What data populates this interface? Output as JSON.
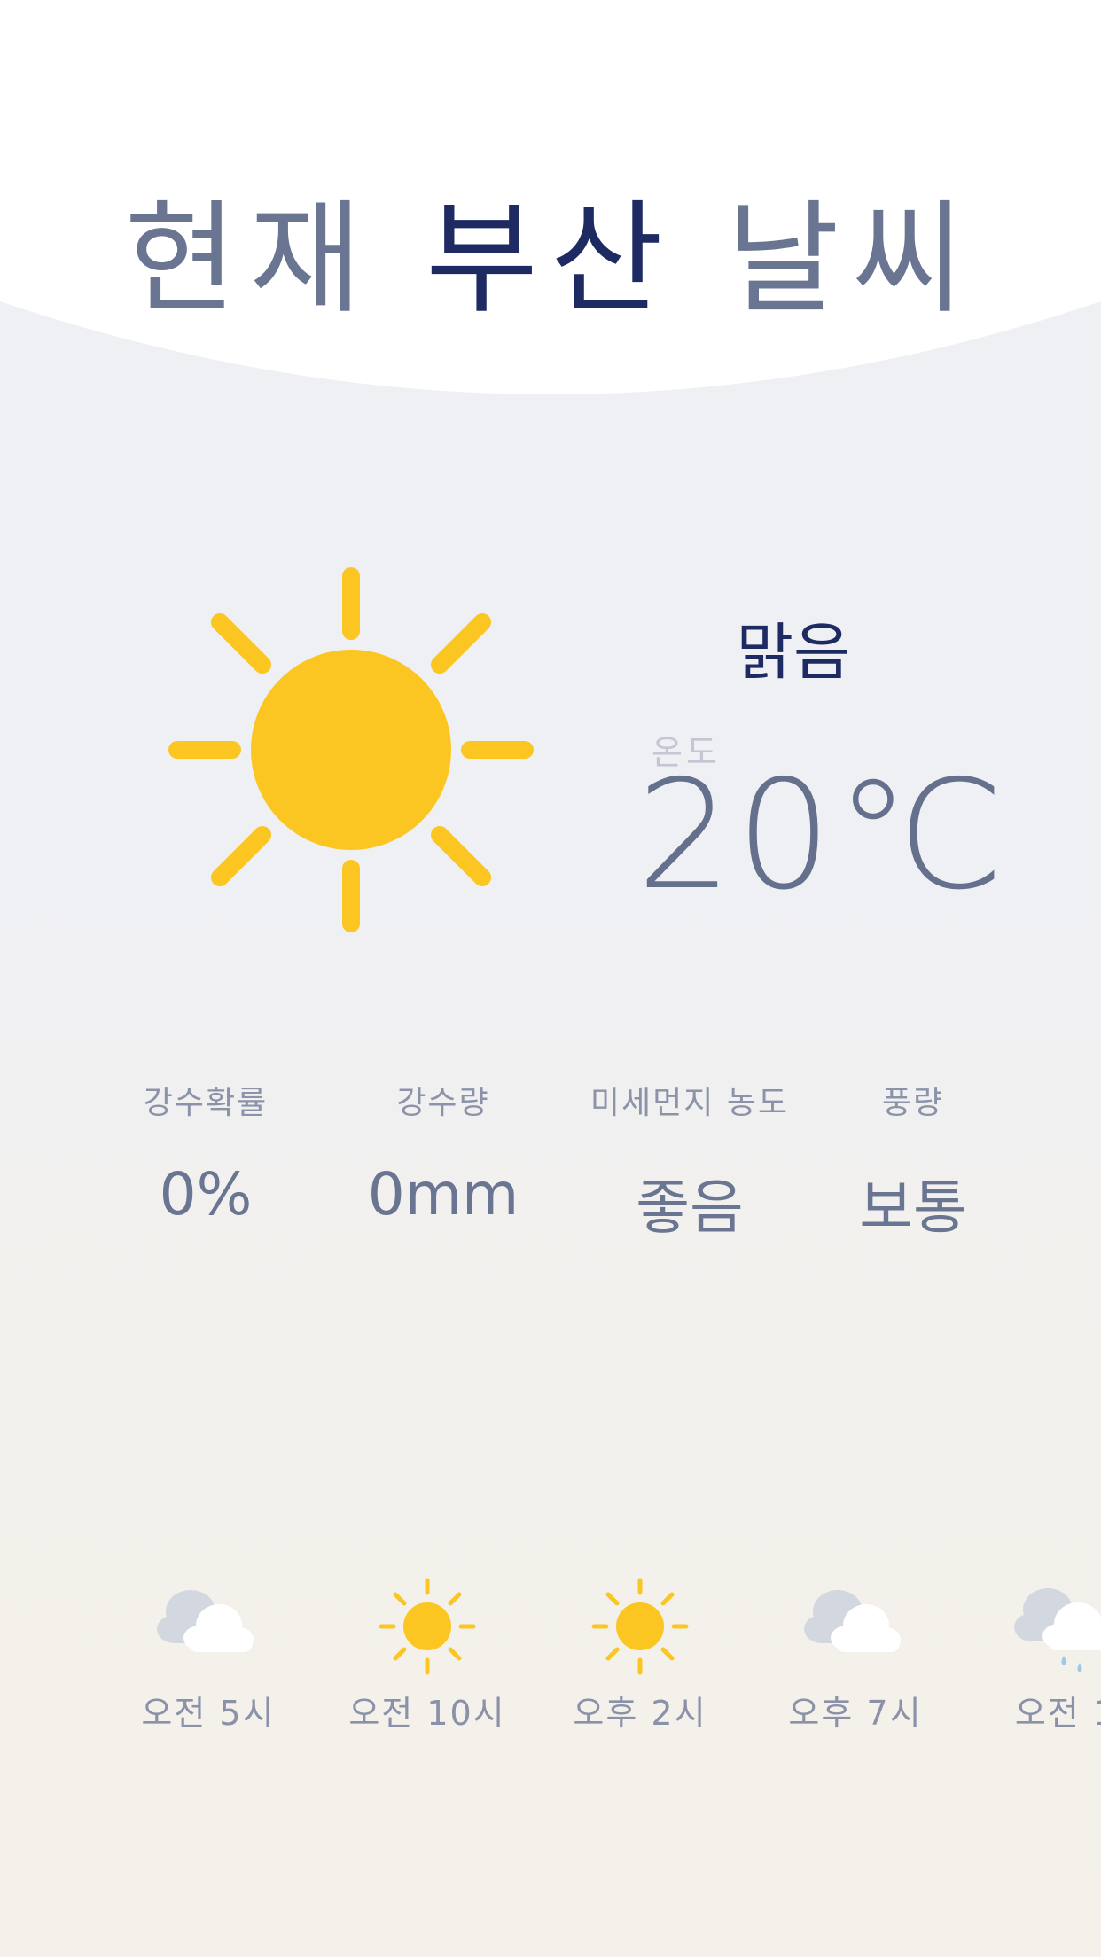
{
  "header": {
    "title_prefix": "현재",
    "city": "부산",
    "title_suffix": "날씨"
  },
  "current": {
    "icon": "sun-icon",
    "condition": "맑음",
    "temp_label": "온도",
    "temperature": "20℃"
  },
  "stats": [
    {
      "label": "강수확률",
      "value": "0%"
    },
    {
      "label": "강수량",
      "value": "0mm"
    },
    {
      "label": "미세먼지 농도",
      "value": "좋음"
    },
    {
      "label": "풍량",
      "value": "보통"
    }
  ],
  "forecast": [
    {
      "icon": "cloud-icon",
      "time": "오전 5시"
    },
    {
      "icon": "sun-icon",
      "time": "오전 10시"
    },
    {
      "icon": "sun-icon",
      "time": "오후 2시"
    },
    {
      "icon": "cloud-icon",
      "time": "오후 7시"
    },
    {
      "icon": "rain-cloud-icon",
      "time": "오전 1"
    }
  ],
  "colors": {
    "accent_navy": "#1e2b63",
    "text_slate": "#6a7591",
    "sun_yellow": "#fcc622",
    "background": "#eff0f4"
  }
}
